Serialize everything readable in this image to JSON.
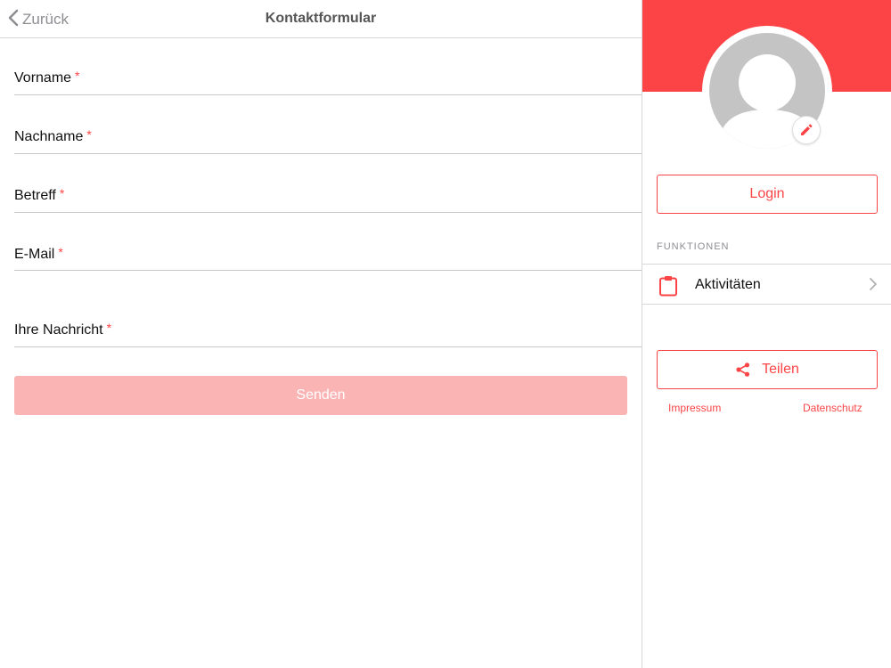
{
  "navbar": {
    "back_label": "Zurück",
    "title": "Kontaktformular"
  },
  "form": {
    "required_mark": "*",
    "fields": [
      {
        "label": "Vorname"
      },
      {
        "label": "Nachname"
      },
      {
        "label": "Betreff"
      },
      {
        "label": "E-Mail"
      },
      {
        "label": "Ihre Nachricht"
      }
    ],
    "submit_label": "Senden"
  },
  "sidebar": {
    "login_label": "Login",
    "section_title": "FUNKTIONEN",
    "menu_items": [
      {
        "label": "Aktivitäten",
        "icon": "clipboard-icon"
      }
    ],
    "share_label": "Teilen",
    "imprint_label": "Impressum",
    "privacy_label": "Datenschutz"
  },
  "colors": {
    "accent": "#fc4446",
    "accent_disabled": "#fbb4b4",
    "muted": "#8e8e93",
    "avatar_gray": "#c4c4c4"
  }
}
